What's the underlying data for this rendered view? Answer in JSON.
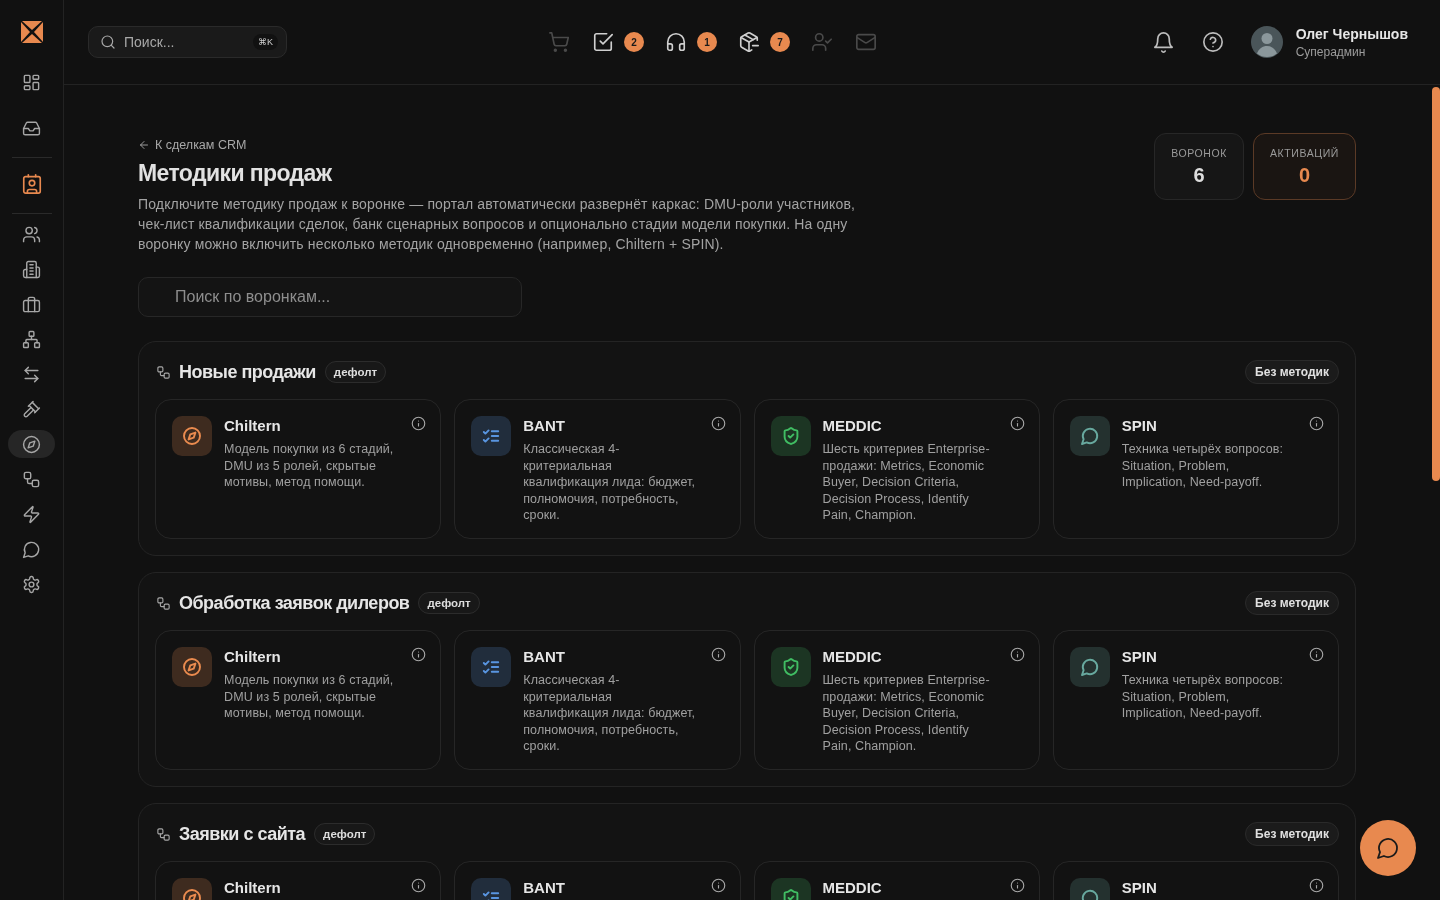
{
  "sidebar": {
    "groups": [
      {
        "items": [
          {
            "kind": "dashboard",
            "selected": false,
            "accent": false
          },
          {
            "kind": "inbox",
            "selected": false,
            "accent": false
          }
        ]
      },
      {
        "items": [
          {
            "kind": "contact",
            "selected": false,
            "accent": true
          }
        ]
      },
      {
        "items": [
          {
            "kind": "users",
            "selected": false,
            "accent": false
          },
          {
            "kind": "building",
            "selected": false,
            "accent": false
          },
          {
            "kind": "briefcase",
            "selected": false,
            "accent": false
          },
          {
            "kind": "network",
            "selected": false,
            "accent": false
          },
          {
            "kind": "transfer",
            "selected": false,
            "accent": false
          },
          {
            "kind": "gavel",
            "selected": false,
            "accent": false
          },
          {
            "kind": "compass",
            "selected": true,
            "accent": false
          },
          {
            "kind": "workflow",
            "selected": false,
            "accent": false
          },
          {
            "kind": "bolt",
            "selected": false,
            "accent": false
          },
          {
            "kind": "chat",
            "selected": false,
            "accent": false
          },
          {
            "kind": "settings",
            "selected": false,
            "accent": false
          }
        ]
      }
    ]
  },
  "topbar": {
    "search": {
      "placeholder": "Поиск...",
      "shortcut": "⌘K"
    },
    "tools": [
      {
        "kind": "cart",
        "disabled": true
      },
      {
        "kind": "tasks",
        "disabled": false,
        "badge": "2"
      },
      {
        "kind": "support",
        "disabled": false,
        "badge": "1"
      },
      {
        "kind": "package",
        "disabled": false,
        "badge": "7"
      },
      {
        "kind": "user_check",
        "disabled": true
      },
      {
        "kind": "mail",
        "disabled": true
      }
    ],
    "user": {
      "name": "Олег Чернышов",
      "role": "Суперадмин"
    }
  },
  "page": {
    "back_link": "К сделкам CRM",
    "title": "Методики продаж",
    "description": "Подключите методику продаж к воронке — портал автоматически развернёт каркас: DMU-роли участников, чек-лист квалификации сделок, банк сценарных вопросов и опционально стадии модели покупки. На одну воронку можно включить несколько методик одновременно (например, Chiltern + SPIN).",
    "stats": [
      {
        "label": "ВОРОНОК",
        "value": "6",
        "highlighted": false
      },
      {
        "label": "АКТИВАЦИЙ",
        "value": "0",
        "highlighted": true
      }
    ],
    "search": {
      "placeholder": "Поиск по воронкам..."
    }
  },
  "funnels": [
    {
      "name": "Новые продажи",
      "badge": "дефолт",
      "status": "Без методик",
      "methods": [
        {
          "kind": "compass",
          "name": "Chiltern",
          "color": "#3e2b1f",
          "description": "Модель покупки из 6 стадий, DMU из 5 ролей, скрытые мотивы, метод помощи."
        },
        {
          "kind": "checklist",
          "name": "BANT",
          "color": "#212d3c",
          "description": "Классическая 4-критериальная квалификация лида: бюджет, полномочия, потребность, сроки."
        },
        {
          "kind": "shield",
          "name": "MEDDIC",
          "color": "#1c3523",
          "description": "Шесть критериев Enterprise-продажи: Metrics, Economic Buyer, Decision Criteria, Decision Process, Identify Pain, Champion."
        },
        {
          "kind": "chat",
          "name": "SPIN",
          "color": "#24312f",
          "description": "Техника четырёх вопросов: Situation, Problem, Implication, Need-payoff."
        }
      ]
    },
    {
      "name": "Обработка заявок дилеров",
      "badge": "дефолт",
      "status": "Без методик",
      "methods": [
        {
          "kind": "compass",
          "name": "Chiltern",
          "color": "#3e2b1f",
          "description": "Модель покупки из 6 стадий, DMU из 5 ролей, скрытые мотивы, метод помощи."
        },
        {
          "kind": "checklist",
          "name": "BANT",
          "color": "#212d3c",
          "description": "Классическая 4-критериальная квалификация лида: бюджет, полномочия, потребность, сроки."
        },
        {
          "kind": "shield",
          "name": "MEDDIC",
          "color": "#1c3523",
          "description": "Шесть критериев Enterprise-продажи: Metrics, Economic Buyer, Decision Criteria, Decision Process, Identify Pain, Champion."
        },
        {
          "kind": "chat",
          "name": "SPIN",
          "color": "#24312f",
          "description": "Техника четырёх вопросов: Situation, Problem, Implication, Need-payoff."
        }
      ]
    },
    {
      "name": "Заявки с сайта",
      "badge": "дефолт",
      "status": "Без методик",
      "methods": [
        {
          "kind": "compass",
          "name": "Chiltern",
          "color": "#3e2b1f"
        },
        {
          "kind": "checklist",
          "name": "BANT",
          "color": "#212d3c"
        },
        {
          "kind": "shield",
          "name": "MEDDIC",
          "color": "#1c3523"
        },
        {
          "kind": "chat",
          "name": "SPIN",
          "color": "#24312f"
        }
      ]
    }
  ]
}
